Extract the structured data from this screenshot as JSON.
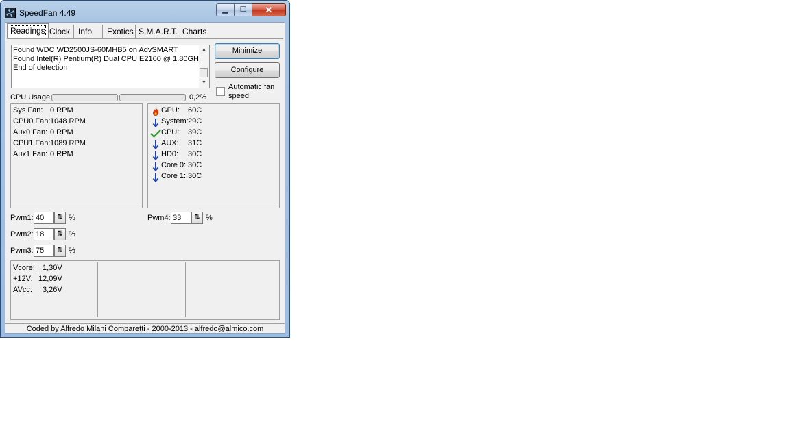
{
  "window": {
    "title": "SpeedFan 4.49",
    "min_glyph": "▁",
    "max_glyph": "☐",
    "close_glyph": "✕"
  },
  "tabs": [
    {
      "label": "Readings",
      "active": true
    },
    {
      "label": "Clock"
    },
    {
      "label": "Info"
    },
    {
      "label": "Exotics"
    },
    {
      "label": "S.M.A.R.T."
    },
    {
      "label": "Charts"
    }
  ],
  "log": {
    "lines": [
      "Found WDC WD2500JS-60MHB5 on AdvSMART",
      "Found Intel(R) Pentium(R) Dual CPU E2160 @ 1.80GHz",
      "End of detection"
    ]
  },
  "buttons": {
    "minimize": "Minimize",
    "configure": "Configure"
  },
  "auto_fan": {
    "label_line1": "Automatic fan",
    "label_line2": "speed",
    "checked": false
  },
  "cpu_usage": {
    "label": "CPU Usage",
    "value": "0,2%",
    "bars": [
      0.0,
      0.0
    ]
  },
  "fans": [
    {
      "name": "Sys Fan:",
      "value": "0 RPM"
    },
    {
      "name": "CPU0 Fan:",
      "value": "1048 RPM"
    },
    {
      "name": "Aux0 Fan:",
      "value": "0 RPM"
    },
    {
      "name": "CPU1 Fan:",
      "value": "1089 RPM"
    },
    {
      "name": "Aux1 Fan:",
      "value": "0 RPM"
    }
  ],
  "temps": [
    {
      "name": "GPU:",
      "value": "60C",
      "icon": "flame-icon"
    },
    {
      "name": "System:",
      "value": "29C",
      "icon": "down-arrow-icon"
    },
    {
      "name": "CPU:",
      "value": "39C",
      "icon": "checkmark-icon"
    },
    {
      "name": "AUX:",
      "value": "31C",
      "icon": "down-arrow-icon"
    },
    {
      "name": "HD0:",
      "value": "30C",
      "icon": "down-arrow-icon"
    },
    {
      "name": "Core 0:",
      "value": "30C",
      "icon": "down-arrow-icon"
    },
    {
      "name": "Core 1:",
      "value": "30C",
      "icon": "down-arrow-icon"
    }
  ],
  "pwm": [
    {
      "label": "Pwm1:",
      "value": "40",
      "unit": "%"
    },
    {
      "label": "Pwm2:",
      "value": "18",
      "unit": "%"
    },
    {
      "label": "Pwm3:",
      "value": "75",
      "unit": "%"
    },
    {
      "label": "Pwm4:",
      "value": "33",
      "unit": "%"
    }
  ],
  "voltages": [
    {
      "name": "Vcore:",
      "value": "1,30V"
    },
    {
      "name": "+12V:",
      "value": "12,09V"
    },
    {
      "name": "AVcc:",
      "value": "3,26V"
    }
  ],
  "status": "Coded by Alfredo Milani Comparetti - 2000-2013 - alfredo@almico.com",
  "colors": {
    "flame": "#d83a10",
    "arrow": "#1a3fb0",
    "check": "#2a9a2a"
  }
}
